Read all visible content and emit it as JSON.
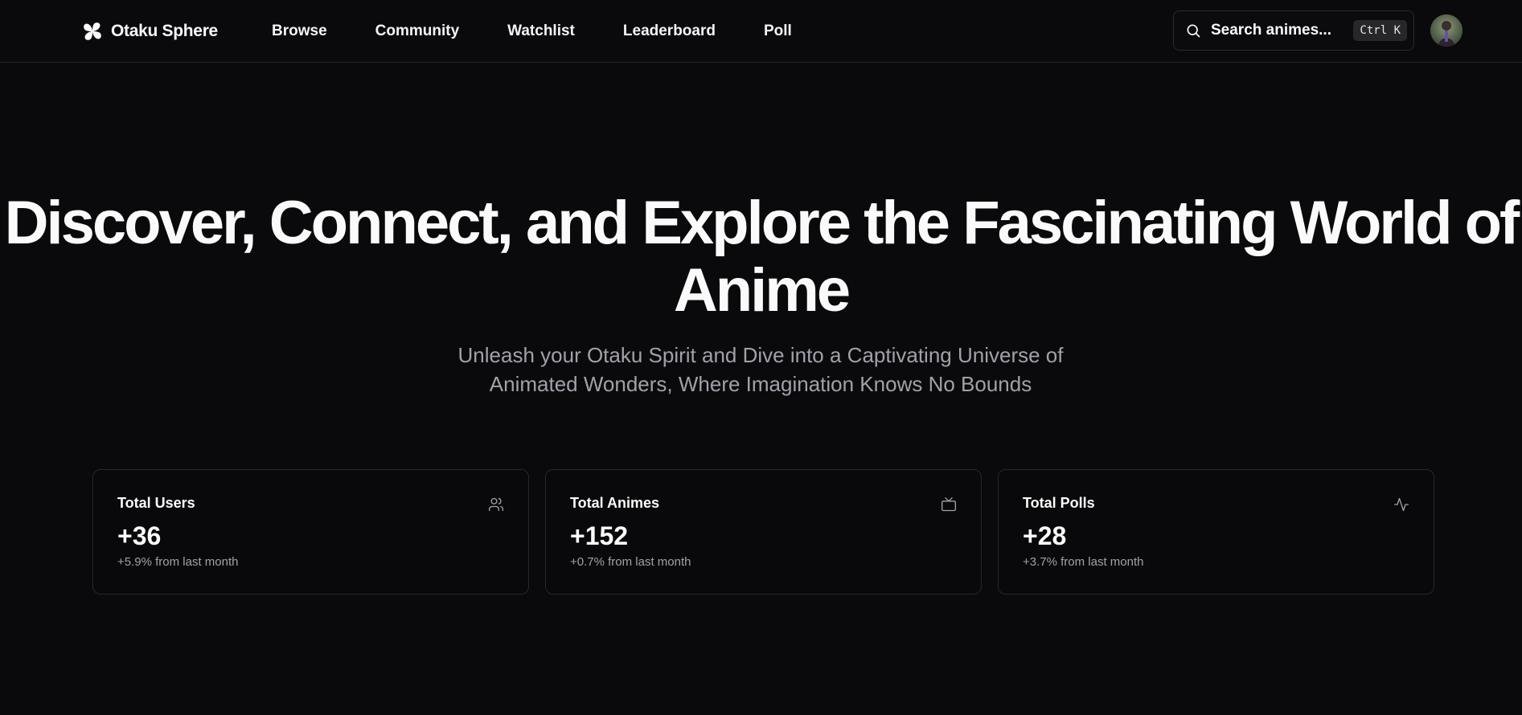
{
  "brand": {
    "name": "Otaku Sphere",
    "icon": "pinwheel-logo-icon"
  },
  "nav": [
    {
      "label": "Browse"
    },
    {
      "label": "Community"
    },
    {
      "label": "Watchlist"
    },
    {
      "label": "Leaderboard"
    },
    {
      "label": "Poll"
    }
  ],
  "search": {
    "placeholder": "Search animes...",
    "value": "",
    "shortcut": "Ctrl K",
    "icon": "search-icon"
  },
  "avatar": {
    "icon": "user-avatar"
  },
  "hero": {
    "title": "Discover, Connect, and Explore the Fascinating World of Anime",
    "subtitle": "Unleash your Otaku Spirit and Dive into a Captivating Universe of Animated Wonders, Where Imagination Knows No Bounds"
  },
  "stats": [
    {
      "label": "Total Users",
      "value": "+36",
      "change": "+5.9% from last month",
      "icon": "users-icon"
    },
    {
      "label": "Total Animes",
      "value": "+152",
      "change": "+0.7% from last month",
      "icon": "tv-icon"
    },
    {
      "label": "Total Polls",
      "value": "+28",
      "change": "+3.7% from last month",
      "icon": "activity-icon"
    }
  ],
  "colors": {
    "background": "#0a0a0c",
    "foreground": "#fafafa",
    "muted": "#a1a1aa",
    "border": "#27272a"
  }
}
